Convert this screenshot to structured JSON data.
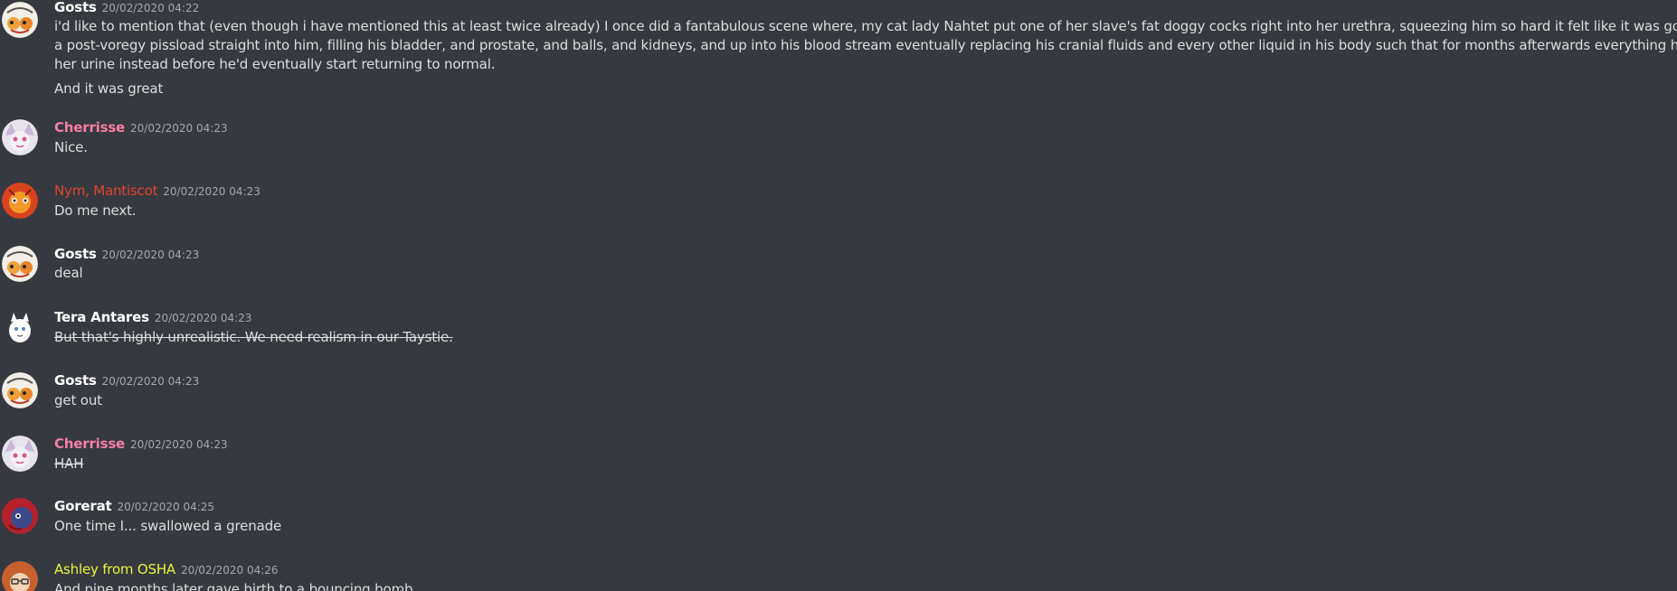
{
  "colors": {
    "background": "#36393f",
    "text": "#dcddde",
    "timestamp": "#a3a6aa",
    "default_author": "#ffffff",
    "pink_author": "#f47fa6",
    "red_author": "#e0452f",
    "yellow_author": "#e8f53a"
  },
  "messages": [
    {
      "author": "Gosts",
      "timestamp": "20/02/2020 04:22",
      "avatar": "gosts-avatar",
      "lines": [
        "i'd like to mention that (even though i have mentioned this at least twice already) I once did a fantabulous scene where, my cat lady Nahtet put one of her slave's fat doggy cocks right into her urethra, squeezing him so hard it felt like it was gonna pop, then unloaded",
        "a post-voregy pissload straight into him, filling his bladder, and prostate, and balls, and kidneys, and up into his blood stream eventually replacing his cranial fluids and every other liquid in his body such that for months afterwards everything he excreted would be",
        "her urine instead before he'd eventually start returning to normal."
      ],
      "followup": "And it was great"
    },
    {
      "author": "Cherrisse",
      "timestamp": "20/02/2020 04:23",
      "avatar": "cherrisse-avatar",
      "text": "Nice."
    },
    {
      "author": "Nym, Mantiscot",
      "timestamp": "20/02/2020 04:23",
      "avatar": "nym-avatar",
      "text": "Do me next."
    },
    {
      "author": "Gosts",
      "timestamp": "20/02/2020 04:23",
      "avatar": "gosts-avatar",
      "text": "deal"
    },
    {
      "author": "Tera Antares",
      "timestamp": "20/02/2020 04:23",
      "avatar": "tera-avatar",
      "text": "But that's highly unrealistic. We need realism in our Taystie."
    },
    {
      "author": "Gosts",
      "timestamp": "20/02/2020 04:23",
      "avatar": "gosts-avatar",
      "text": "get out"
    },
    {
      "author": "Cherrisse",
      "timestamp": "20/02/2020 04:23",
      "avatar": "cherrisse-avatar",
      "text": "HAH"
    },
    {
      "author": "Gorerat",
      "timestamp": "20/02/2020 04:25",
      "avatar": "gorerat-avatar",
      "text": "One time I... swallowed a grenade"
    },
    {
      "author": "Ashley from OSHA",
      "timestamp": "20/02/2020 04:26",
      "avatar": "ashley-avatar",
      "text": "And nine months later gave birth to a bouncing bomb"
    }
  ]
}
